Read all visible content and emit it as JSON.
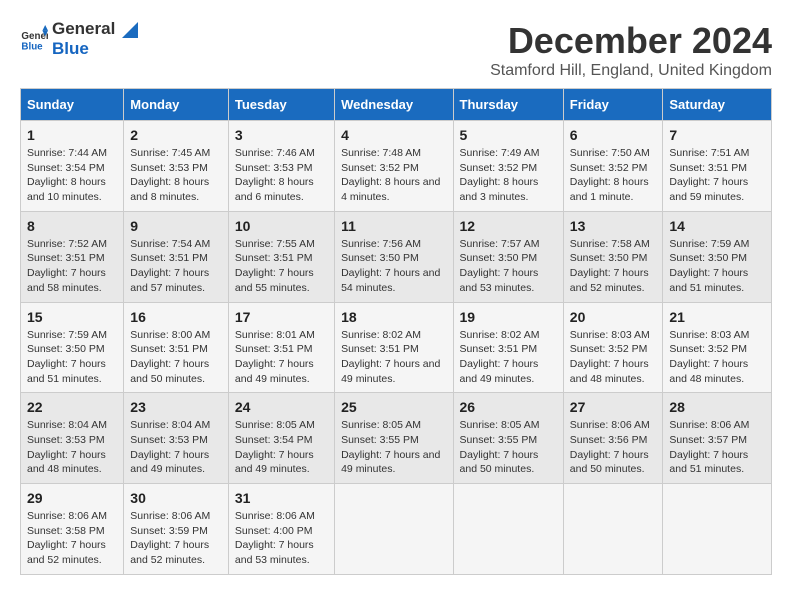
{
  "logo": {
    "general": "General",
    "blue": "Blue"
  },
  "title": "December 2024",
  "location": "Stamford Hill, England, United Kingdom",
  "weekdays": [
    "Sunday",
    "Monday",
    "Tuesday",
    "Wednesday",
    "Thursday",
    "Friday",
    "Saturday"
  ],
  "weeks": [
    [
      {
        "day": "1",
        "sunrise": "7:44 AM",
        "sunset": "3:54 PM",
        "daylight": "8 hours and 10 minutes."
      },
      {
        "day": "2",
        "sunrise": "7:45 AM",
        "sunset": "3:53 PM",
        "daylight": "8 hours and 8 minutes."
      },
      {
        "day": "3",
        "sunrise": "7:46 AM",
        "sunset": "3:53 PM",
        "daylight": "8 hours and 6 minutes."
      },
      {
        "day": "4",
        "sunrise": "7:48 AM",
        "sunset": "3:52 PM",
        "daylight": "8 hours and 4 minutes."
      },
      {
        "day": "5",
        "sunrise": "7:49 AM",
        "sunset": "3:52 PM",
        "daylight": "8 hours and 3 minutes."
      },
      {
        "day": "6",
        "sunrise": "7:50 AM",
        "sunset": "3:52 PM",
        "daylight": "8 hours and 1 minute."
      },
      {
        "day": "7",
        "sunrise": "7:51 AM",
        "sunset": "3:51 PM",
        "daylight": "7 hours and 59 minutes."
      }
    ],
    [
      {
        "day": "8",
        "sunrise": "7:52 AM",
        "sunset": "3:51 PM",
        "daylight": "7 hours and 58 minutes."
      },
      {
        "day": "9",
        "sunrise": "7:54 AM",
        "sunset": "3:51 PM",
        "daylight": "7 hours and 57 minutes."
      },
      {
        "day": "10",
        "sunrise": "7:55 AM",
        "sunset": "3:51 PM",
        "daylight": "7 hours and 55 minutes."
      },
      {
        "day": "11",
        "sunrise": "7:56 AM",
        "sunset": "3:50 PM",
        "daylight": "7 hours and 54 minutes."
      },
      {
        "day": "12",
        "sunrise": "7:57 AM",
        "sunset": "3:50 PM",
        "daylight": "7 hours and 53 minutes."
      },
      {
        "day": "13",
        "sunrise": "7:58 AM",
        "sunset": "3:50 PM",
        "daylight": "7 hours and 52 minutes."
      },
      {
        "day": "14",
        "sunrise": "7:59 AM",
        "sunset": "3:50 PM",
        "daylight": "7 hours and 51 minutes."
      }
    ],
    [
      {
        "day": "15",
        "sunrise": "7:59 AM",
        "sunset": "3:50 PM",
        "daylight": "7 hours and 51 minutes."
      },
      {
        "day": "16",
        "sunrise": "8:00 AM",
        "sunset": "3:51 PM",
        "daylight": "7 hours and 50 minutes."
      },
      {
        "day": "17",
        "sunrise": "8:01 AM",
        "sunset": "3:51 PM",
        "daylight": "7 hours and 49 minutes."
      },
      {
        "day": "18",
        "sunrise": "8:02 AM",
        "sunset": "3:51 PM",
        "daylight": "7 hours and 49 minutes."
      },
      {
        "day": "19",
        "sunrise": "8:02 AM",
        "sunset": "3:51 PM",
        "daylight": "7 hours and 49 minutes."
      },
      {
        "day": "20",
        "sunrise": "8:03 AM",
        "sunset": "3:52 PM",
        "daylight": "7 hours and 48 minutes."
      },
      {
        "day": "21",
        "sunrise": "8:03 AM",
        "sunset": "3:52 PM",
        "daylight": "7 hours and 48 minutes."
      }
    ],
    [
      {
        "day": "22",
        "sunrise": "8:04 AM",
        "sunset": "3:53 PM",
        "daylight": "7 hours and 48 minutes."
      },
      {
        "day": "23",
        "sunrise": "8:04 AM",
        "sunset": "3:53 PM",
        "daylight": "7 hours and 49 minutes."
      },
      {
        "day": "24",
        "sunrise": "8:05 AM",
        "sunset": "3:54 PM",
        "daylight": "7 hours and 49 minutes."
      },
      {
        "day": "25",
        "sunrise": "8:05 AM",
        "sunset": "3:55 PM",
        "daylight": "7 hours and 49 minutes."
      },
      {
        "day": "26",
        "sunrise": "8:05 AM",
        "sunset": "3:55 PM",
        "daylight": "7 hours and 50 minutes."
      },
      {
        "day": "27",
        "sunrise": "8:06 AM",
        "sunset": "3:56 PM",
        "daylight": "7 hours and 50 minutes."
      },
      {
        "day": "28",
        "sunrise": "8:06 AM",
        "sunset": "3:57 PM",
        "daylight": "7 hours and 51 minutes."
      }
    ],
    [
      {
        "day": "29",
        "sunrise": "8:06 AM",
        "sunset": "3:58 PM",
        "daylight": "7 hours and 52 minutes."
      },
      {
        "day": "30",
        "sunrise": "8:06 AM",
        "sunset": "3:59 PM",
        "daylight": "7 hours and 52 minutes."
      },
      {
        "day": "31",
        "sunrise": "8:06 AM",
        "sunset": "4:00 PM",
        "daylight": "7 hours and 53 minutes."
      },
      null,
      null,
      null,
      null
    ]
  ]
}
